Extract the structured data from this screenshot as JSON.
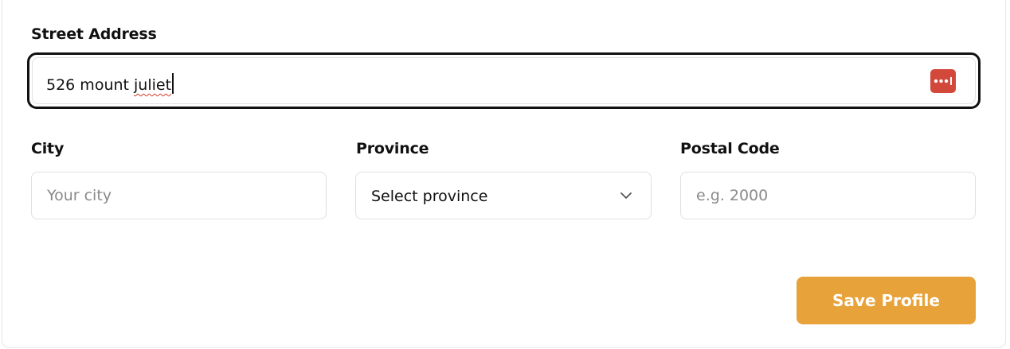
{
  "street": {
    "label": "Street Address",
    "value_prefix": "526 mount ",
    "value_misspelled": "juliet",
    "password_manager_icon": "password-dots-icon",
    "icon_color": "#d2483a"
  },
  "city": {
    "label": "City",
    "placeholder": "Your city"
  },
  "province": {
    "label": "Province",
    "selected": "Select province",
    "icon": "chevron-down-icon"
  },
  "postal": {
    "label": "Postal Code",
    "placeholder": "e.g. 2000"
  },
  "actions": {
    "save_label": "Save Profile",
    "save_color": "#e8a23a"
  }
}
